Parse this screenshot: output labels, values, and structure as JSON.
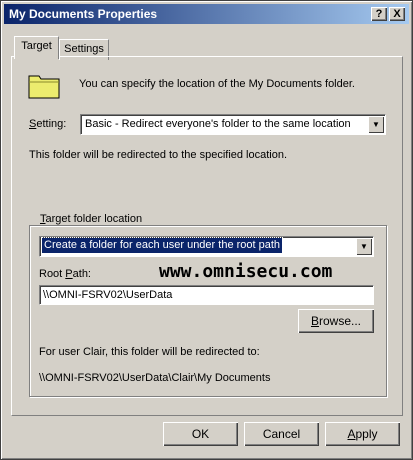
{
  "window": {
    "title": "My Documents Properties",
    "help_btn": "?",
    "close_btn": "X"
  },
  "tabs": [
    {
      "label": "Target"
    },
    {
      "label": "Settings"
    }
  ],
  "target": {
    "description": "You can specify the location of the My Documents folder.",
    "setting_label": "Setting:",
    "setting_value": "Basic - Redirect everyone's folder to the same location",
    "redirect_text": "This folder will be redirected to the specified location.",
    "group_label": "Target folder location",
    "location_option": "Create a folder for each user under the root path",
    "root_path_label": "Root Path:",
    "root_path_value": "\\\\OMNI-FSRV02\\UserData",
    "browse_button": "Browse...",
    "user_info": "For user Clair, this folder will be redirected to:",
    "redirect_path": "\\\\OMNI-FSRV02\\UserData\\Clair\\My Documents"
  },
  "watermark": "www.omnisecu.com",
  "buttons": {
    "ok": "OK",
    "cancel": "Cancel",
    "apply": "Apply"
  }
}
